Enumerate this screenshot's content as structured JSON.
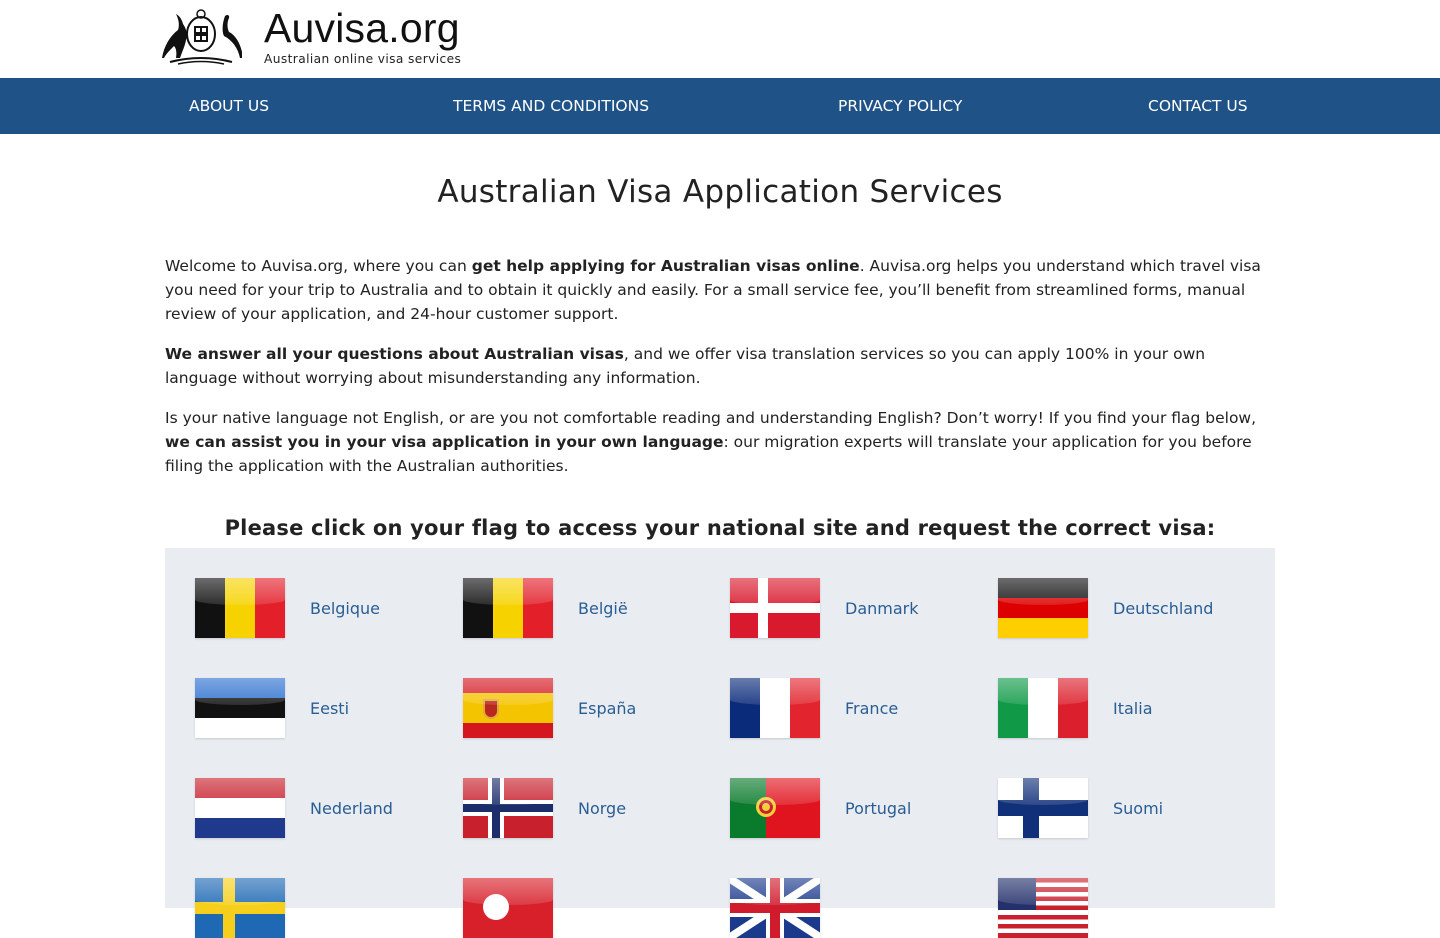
{
  "logo": {
    "name_brand": "Auvisa",
    "name_tld": ".org",
    "tagline": "Australian online visa services"
  },
  "nav": {
    "about": "ABOUT US",
    "terms": "TERMS AND CONDITIONS",
    "privacy": "PRIVACY POLICY",
    "contact": "CONTACT US"
  },
  "page": {
    "title": "Australian Visa Application Services",
    "p1_a": "Welcome to Auvisa.org, where you can ",
    "p1_b": "get help applying for Australian visas online",
    "p1_c": ". Auvisa.org helps you understand which travel visa you need for your trip to Australia and to obtain it quickly and easily. For a small service fee, you’ll benefit from streamlined forms, manual review of your application, and 24-hour customer support.",
    "p2_a": "We answer all your questions about Australian visas",
    "p2_b": ", and we offer visa translation services so you can apply 100% in your own language without worrying about misunderstanding any information.",
    "p3_a": "Is your native language not English, or are you not comfortable reading and understanding English? Don’t worry! If you find your flag below, ",
    "p3_b": "we can assist you in your visa application in your own language",
    "p3_c": ": our migration experts will translate your application for you before filing the application with the Australian authorities.",
    "flags_heading": "Please click on your flag to access your national site and request the correct visa:"
  },
  "flags": [
    {
      "label": "Belgique",
      "icon": "belgium-flag-icon"
    },
    {
      "label": "België",
      "icon": "belgium-flag-icon"
    },
    {
      "label": "Danmark",
      "icon": "denmark-flag-icon"
    },
    {
      "label": "Deutschland",
      "icon": "germany-flag-icon"
    },
    {
      "label": "Eesti",
      "icon": "estonia-flag-icon"
    },
    {
      "label": "España",
      "icon": "spain-flag-icon"
    },
    {
      "label": "France",
      "icon": "france-flag-icon"
    },
    {
      "label": "Italia",
      "icon": "italy-flag-icon"
    },
    {
      "label": "Nederland",
      "icon": "netherlands-flag-icon"
    },
    {
      "label": "Norge",
      "icon": "norway-flag-icon"
    },
    {
      "label": "Portugal",
      "icon": "portugal-flag-icon"
    },
    {
      "label": "Suomi",
      "icon": "finland-flag-icon"
    },
    {
      "label": "",
      "icon": "sweden-flag-icon"
    },
    {
      "label": "",
      "icon": "turkey-flag-icon"
    },
    {
      "label": "",
      "icon": "uk-flag-icon"
    },
    {
      "label": "",
      "icon": "usa-flag-icon"
    }
  ],
  "colors": {
    "nav_bg": "#1f5286",
    "link": "#2a5d93",
    "panel_bg": "#e9edf2"
  }
}
